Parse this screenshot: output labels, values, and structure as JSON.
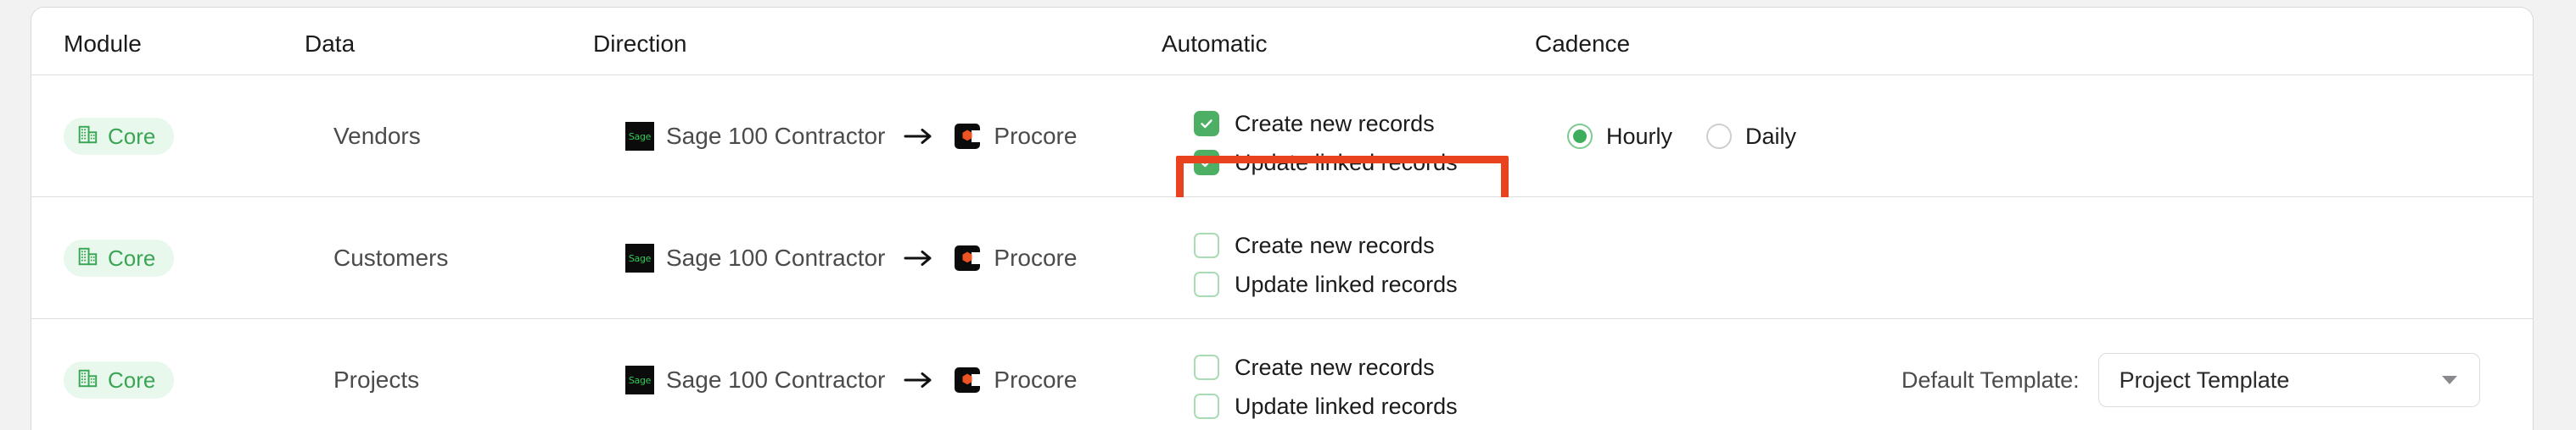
{
  "table": {
    "columns": [
      {
        "key": "module",
        "label": "Module"
      },
      {
        "key": "data",
        "label": "Data"
      },
      {
        "key": "direction",
        "label": "Direction"
      },
      {
        "key": "automatic",
        "label": "Automatic"
      },
      {
        "key": "cadence",
        "label": "Cadence"
      }
    ],
    "rows": [
      {
        "module_badge": "Core",
        "module_icon": "building-icon",
        "data": "Vendors",
        "source": "Sage 100 Contractor",
        "source_icon": "sage-logo-icon",
        "direction_icon": "arrow-right-icon",
        "target": "Procore",
        "target_icon": "procore-logo-icon",
        "automatic": {
          "create": {
            "label": "Create new records",
            "checked": true
          },
          "update": {
            "label": "Update linked records",
            "checked": true
          }
        },
        "highlighted": true,
        "cadence": {
          "options": [
            {
              "label": "Hourly",
              "selected": true
            },
            {
              "label": "Daily",
              "selected": false
            }
          ]
        },
        "template": null
      },
      {
        "module_badge": "Core",
        "module_icon": "building-icon",
        "data": "Customers",
        "source": "Sage 100 Contractor",
        "source_icon": "sage-logo-icon",
        "direction_icon": "arrow-right-icon",
        "target": "Procore",
        "target_icon": "procore-logo-icon",
        "automatic": {
          "create": {
            "label": "Create new records",
            "checked": false
          },
          "update": {
            "label": "Update linked records",
            "checked": false
          }
        },
        "highlighted": false,
        "cadence": null,
        "template": null
      },
      {
        "module_badge": "Core",
        "module_icon": "building-icon",
        "data": "Projects",
        "source": "Sage 100 Contractor",
        "source_icon": "sage-logo-icon",
        "direction_icon": "arrow-right-icon",
        "target": "Procore",
        "target_icon": "procore-logo-icon",
        "automatic": {
          "create": {
            "label": "Create new records",
            "checked": false
          },
          "update": {
            "label": "Update linked records",
            "checked": false
          }
        },
        "highlighted": false,
        "cadence": null,
        "template": {
          "label": "Default Template:",
          "value": "Project Template",
          "caret_icon": "chevron-down-icon"
        }
      }
    ]
  },
  "colors": {
    "highlight_border": "#e8421f",
    "badge_text": "#3aa655",
    "badge_bg": "#e8f8ec",
    "checkbox_checked": "#4caf63",
    "checkbox_unchecked_border": "#a9dcb4",
    "radio_selected": "#3fae5c",
    "page_bg": "#f2f2f3",
    "sage_logo_bg": "#0b0b0b",
    "sage_logo_text": "#2ecc56",
    "procore_accent": "#ef5323"
  }
}
